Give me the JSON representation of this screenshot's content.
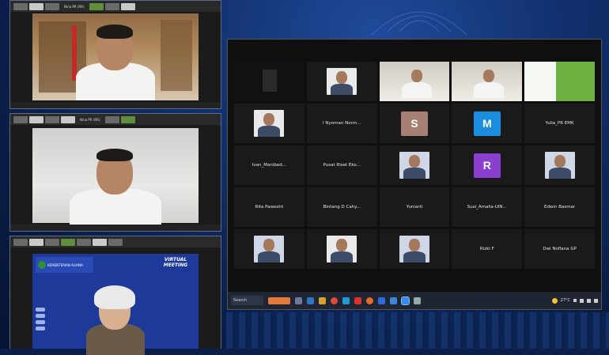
{
  "left_frames": [
    {
      "id": "frame-1",
      "strip_label": "Nina PR (RR)"
    },
    {
      "id": "frame-2",
      "strip_label": "Nina PR (RR)"
    },
    {
      "id": "frame-3",
      "slide_title": "VIRTUAL MEETING",
      "slide_org": "KEMENTERIAN AGAMA"
    }
  ],
  "gallery": {
    "tiles": [
      {
        "kind": "video",
        "active": true,
        "name": ""
      },
      {
        "kind": "photo",
        "name": ""
      },
      {
        "kind": "video",
        "name": ""
      },
      {
        "kind": "video",
        "name": ""
      },
      {
        "kind": "slide",
        "name": ""
      },
      {
        "kind": "photo",
        "name": ""
      },
      {
        "kind": "name",
        "name": "I Nyoman Norm..."
      },
      {
        "kind": "avatar",
        "letter": "S",
        "color": "#a87f74",
        "name": ""
      },
      {
        "kind": "avatar",
        "letter": "M",
        "color": "#1b8ee0",
        "name": ""
      },
      {
        "kind": "name",
        "name": "Yulia_PR EMK"
      },
      {
        "kind": "name",
        "name": "Ivan_Manibed..."
      },
      {
        "kind": "name",
        "name": "Pusat Riset Eko..."
      },
      {
        "kind": "photo",
        "name": ""
      },
      {
        "kind": "avatar",
        "letter": "R",
        "color": "#8b3fcf",
        "name": ""
      },
      {
        "kind": "photo",
        "name": ""
      },
      {
        "kind": "name",
        "name": "Rita Pawestri"
      },
      {
        "kind": "name",
        "name": "Bintang D Cahy..."
      },
      {
        "kind": "name",
        "name": "Yuniarti"
      },
      {
        "kind": "name",
        "name": "Susi_Amalia-UIN..."
      },
      {
        "kind": "name",
        "name": "Edwin Basmar"
      },
      {
        "kind": "photo",
        "name": ""
      },
      {
        "kind": "photo",
        "name": ""
      },
      {
        "kind": "photo",
        "name": ""
      },
      {
        "kind": "name",
        "name": "Rizki F"
      },
      {
        "kind": "name",
        "name": "Dwi Noflana GP"
      }
    ]
  },
  "taskbar": {
    "search_label": "Search",
    "temperature": "27°C"
  },
  "colors": {
    "active_border": "#c5d21c",
    "background": "#0b1f4a"
  }
}
